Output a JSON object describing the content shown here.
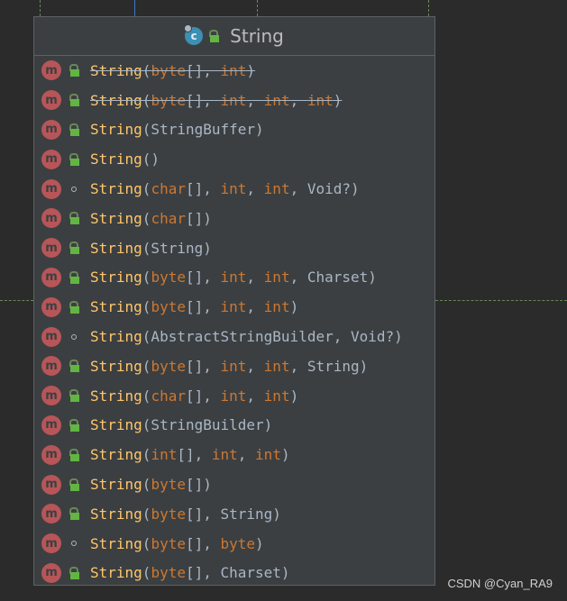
{
  "diagram": {
    "class_name": "String",
    "class_icon_letter": "c",
    "method_icon_letter": "m",
    "colors": {
      "background": "#2b2b2b",
      "box": "#3c3f41",
      "method_name": "#ffc66d",
      "keyword": "#cc7832",
      "plain": "#a9b7c6",
      "method_icon": "#b85558",
      "public_lock": "#62b543"
    },
    "members": [
      {
        "visibility": "public",
        "deprecated": true,
        "tokens": [
          [
            "name",
            "String"
          ],
          [
            "plain",
            "("
          ],
          [
            "kw",
            "byte"
          ],
          [
            "plain",
            "[], "
          ],
          [
            "kw",
            "int"
          ],
          [
            "plain",
            ")"
          ]
        ]
      },
      {
        "visibility": "public",
        "deprecated": true,
        "tokens": [
          [
            "name",
            "String"
          ],
          [
            "plain",
            "("
          ],
          [
            "kw",
            "byte"
          ],
          [
            "plain",
            "[], "
          ],
          [
            "kw",
            "int"
          ],
          [
            "plain",
            ", "
          ],
          [
            "kw",
            "int"
          ],
          [
            "plain",
            ", "
          ],
          [
            "kw",
            "int"
          ],
          [
            "plain",
            ")"
          ]
        ]
      },
      {
        "visibility": "public",
        "deprecated": false,
        "tokens": [
          [
            "name",
            "String"
          ],
          [
            "plain",
            "(StringBuffer)"
          ]
        ]
      },
      {
        "visibility": "public",
        "deprecated": false,
        "tokens": [
          [
            "name",
            "String"
          ],
          [
            "plain",
            "()"
          ]
        ]
      },
      {
        "visibility": "package",
        "deprecated": false,
        "tokens": [
          [
            "name",
            "String"
          ],
          [
            "plain",
            "("
          ],
          [
            "kw",
            "char"
          ],
          [
            "plain",
            "[], "
          ],
          [
            "kw",
            "int"
          ],
          [
            "plain",
            ", "
          ],
          [
            "kw",
            "int"
          ],
          [
            "plain",
            ", Void?)"
          ]
        ]
      },
      {
        "visibility": "public",
        "deprecated": false,
        "tokens": [
          [
            "name",
            "String"
          ],
          [
            "plain",
            "("
          ],
          [
            "kw",
            "char"
          ],
          [
            "plain",
            "[])"
          ]
        ]
      },
      {
        "visibility": "public",
        "deprecated": false,
        "tokens": [
          [
            "name",
            "String"
          ],
          [
            "plain",
            "(String)"
          ]
        ]
      },
      {
        "visibility": "public",
        "deprecated": false,
        "tokens": [
          [
            "name",
            "String"
          ],
          [
            "plain",
            "("
          ],
          [
            "kw",
            "byte"
          ],
          [
            "plain",
            "[], "
          ],
          [
            "kw",
            "int"
          ],
          [
            "plain",
            ", "
          ],
          [
            "kw",
            "int"
          ],
          [
            "plain",
            ", Charset)"
          ]
        ]
      },
      {
        "visibility": "public",
        "deprecated": false,
        "tokens": [
          [
            "name",
            "String"
          ],
          [
            "plain",
            "("
          ],
          [
            "kw",
            "byte"
          ],
          [
            "plain",
            "[], "
          ],
          [
            "kw",
            "int"
          ],
          [
            "plain",
            ", "
          ],
          [
            "kw",
            "int"
          ],
          [
            "plain",
            ")"
          ]
        ]
      },
      {
        "visibility": "package",
        "deprecated": false,
        "tokens": [
          [
            "name",
            "String"
          ],
          [
            "plain",
            "(AbstractStringBuilder, Void?)"
          ]
        ]
      },
      {
        "visibility": "public",
        "deprecated": false,
        "tokens": [
          [
            "name",
            "String"
          ],
          [
            "plain",
            "("
          ],
          [
            "kw",
            "byte"
          ],
          [
            "plain",
            "[], "
          ],
          [
            "kw",
            "int"
          ],
          [
            "plain",
            ", "
          ],
          [
            "kw",
            "int"
          ],
          [
            "plain",
            ", String)"
          ]
        ]
      },
      {
        "visibility": "public",
        "deprecated": false,
        "tokens": [
          [
            "name",
            "String"
          ],
          [
            "plain",
            "("
          ],
          [
            "kw",
            "char"
          ],
          [
            "plain",
            "[], "
          ],
          [
            "kw",
            "int"
          ],
          [
            "plain",
            ", "
          ],
          [
            "kw",
            "int"
          ],
          [
            "plain",
            ")"
          ]
        ]
      },
      {
        "visibility": "public",
        "deprecated": false,
        "tokens": [
          [
            "name",
            "String"
          ],
          [
            "plain",
            "(StringBuilder)"
          ]
        ]
      },
      {
        "visibility": "public",
        "deprecated": false,
        "tokens": [
          [
            "name",
            "String"
          ],
          [
            "plain",
            "("
          ],
          [
            "kw",
            "int"
          ],
          [
            "plain",
            "[], "
          ],
          [
            "kw",
            "int"
          ],
          [
            "plain",
            ", "
          ],
          [
            "kw",
            "int"
          ],
          [
            "plain",
            ")"
          ]
        ]
      },
      {
        "visibility": "public",
        "deprecated": false,
        "tokens": [
          [
            "name",
            "String"
          ],
          [
            "plain",
            "("
          ],
          [
            "kw",
            "byte"
          ],
          [
            "plain",
            "[])"
          ]
        ]
      },
      {
        "visibility": "public",
        "deprecated": false,
        "tokens": [
          [
            "name",
            "String"
          ],
          [
            "plain",
            "("
          ],
          [
            "kw",
            "byte"
          ],
          [
            "plain",
            "[], String)"
          ]
        ]
      },
      {
        "visibility": "package",
        "deprecated": false,
        "tokens": [
          [
            "name",
            "String"
          ],
          [
            "plain",
            "("
          ],
          [
            "kw",
            "byte"
          ],
          [
            "plain",
            "[], "
          ],
          [
            "kw",
            "byte"
          ],
          [
            "plain",
            ")"
          ]
        ]
      },
      {
        "visibility": "public",
        "deprecated": false,
        "tokens": [
          [
            "name",
            "String"
          ],
          [
            "plain",
            "("
          ],
          [
            "kw",
            "byte"
          ],
          [
            "plain",
            "[], Charset)"
          ]
        ]
      }
    ]
  },
  "watermark": "CSDN @Cyan_RA9"
}
